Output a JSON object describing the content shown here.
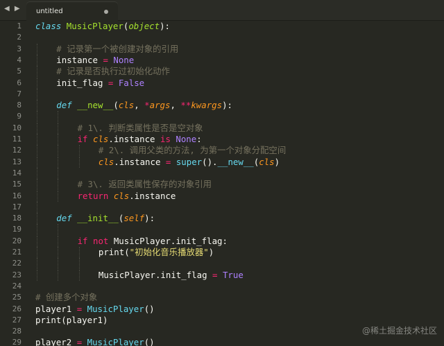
{
  "tabbar": {
    "back_icon": "◀",
    "forward_icon": "▶",
    "tab_title": "untitled",
    "dirty_indicator": "unsaved-dot"
  },
  "editor": {
    "colors": {
      "background": "#272822",
      "keyword": "#66d9ef",
      "class_name": "#a6e22e",
      "comment": "#75715e",
      "operator": "#f92672",
      "constant": "#ae81ff",
      "string": "#e6db74",
      "parameter": "#fd971f",
      "text": "#f8f8f2"
    },
    "lines": [
      {
        "n": "1",
        "indent": 0,
        "tokens": [
          [
            "kw",
            "class"
          ],
          [
            "plain",
            " "
          ],
          [
            "cls",
            "MusicPlayer"
          ],
          [
            "plain",
            "("
          ],
          [
            "base",
            "object"
          ],
          [
            "plain",
            "):"
          ]
        ]
      },
      {
        "n": "2",
        "indent": 0,
        "tokens": []
      },
      {
        "n": "3",
        "indent": 1,
        "tokens": [
          [
            "cm",
            "# 记录第一个被创建对象的引用"
          ]
        ]
      },
      {
        "n": "4",
        "indent": 1,
        "tokens": [
          [
            "plain",
            "instance "
          ],
          [
            "op",
            "="
          ],
          [
            "plain",
            " "
          ],
          [
            "const",
            "None"
          ]
        ]
      },
      {
        "n": "5",
        "indent": 1,
        "tokens": [
          [
            "cm",
            "# 记录是否执行过初始化动作"
          ]
        ]
      },
      {
        "n": "6",
        "indent": 1,
        "tokens": [
          [
            "plain",
            "init_flag "
          ],
          [
            "op",
            "="
          ],
          [
            "plain",
            " "
          ],
          [
            "const",
            "False"
          ]
        ]
      },
      {
        "n": "7",
        "indent": 1,
        "tokens": []
      },
      {
        "n": "8",
        "indent": 1,
        "tokens": [
          [
            "kw",
            "def"
          ],
          [
            "plain",
            " "
          ],
          [
            "fn",
            "__new__"
          ],
          [
            "plain",
            "("
          ],
          [
            "param",
            "cls"
          ],
          [
            "plain",
            ", "
          ],
          [
            "op",
            "*"
          ],
          [
            "param",
            "args"
          ],
          [
            "plain",
            ", "
          ],
          [
            "op",
            "**"
          ],
          [
            "param",
            "kwargs"
          ],
          [
            "plain",
            "):"
          ]
        ]
      },
      {
        "n": "9",
        "indent": 2,
        "tokens": []
      },
      {
        "n": "10",
        "indent": 2,
        "tokens": [
          [
            "cm",
            "# 1\\. 判断类属性是否是空对象"
          ]
        ]
      },
      {
        "n": "11",
        "indent": 2,
        "tokens": [
          [
            "ctrl",
            "if"
          ],
          [
            "plain",
            " "
          ],
          [
            "param",
            "cls"
          ],
          [
            "plain",
            ".instance "
          ],
          [
            "ctrl",
            "is"
          ],
          [
            "plain",
            " "
          ],
          [
            "const",
            "None"
          ],
          [
            "plain",
            ":"
          ]
        ]
      },
      {
        "n": "12",
        "indent": 3,
        "tokens": [
          [
            "cm",
            "# 2\\. 调用父类的方法, 为第一个对象分配空间"
          ]
        ]
      },
      {
        "n": "13",
        "indent": 3,
        "tokens": [
          [
            "param",
            "cls"
          ],
          [
            "plain",
            ".instance "
          ],
          [
            "op",
            "="
          ],
          [
            "plain",
            " "
          ],
          [
            "bi",
            "super"
          ],
          [
            "plain",
            "()."
          ],
          [
            "bi",
            "__new__"
          ],
          [
            "plain",
            "("
          ],
          [
            "param",
            "cls"
          ],
          [
            "plain",
            ")"
          ]
        ]
      },
      {
        "n": "14",
        "indent": 2,
        "tokens": []
      },
      {
        "n": "15",
        "indent": 2,
        "tokens": [
          [
            "cm",
            "# 3\\. 返回类属性保存的对象引用"
          ]
        ]
      },
      {
        "n": "16",
        "indent": 2,
        "tokens": [
          [
            "ctrl",
            "return"
          ],
          [
            "plain",
            " "
          ],
          [
            "param",
            "cls"
          ],
          [
            "plain",
            ".instance"
          ]
        ]
      },
      {
        "n": "17",
        "indent": 1,
        "tokens": []
      },
      {
        "n": "18",
        "indent": 1,
        "tokens": [
          [
            "kw",
            "def"
          ],
          [
            "plain",
            " "
          ],
          [
            "fn",
            "__init__"
          ],
          [
            "plain",
            "("
          ],
          [
            "param",
            "self"
          ],
          [
            "plain",
            "):"
          ]
        ]
      },
      {
        "n": "19",
        "indent": 2,
        "tokens": []
      },
      {
        "n": "20",
        "indent": 2,
        "tokens": [
          [
            "ctrl",
            "if"
          ],
          [
            "plain",
            " "
          ],
          [
            "ctrl",
            "not"
          ],
          [
            "plain",
            " MusicPlayer.init_flag:"
          ]
        ]
      },
      {
        "n": "21",
        "indent": 3,
        "tokens": [
          [
            "plain",
            "print("
          ],
          [
            "str",
            "\"初始化音乐播放器\""
          ],
          [
            "plain",
            ")"
          ]
        ]
      },
      {
        "n": "22",
        "indent": 3,
        "tokens": []
      },
      {
        "n": "23",
        "indent": 3,
        "tokens": [
          [
            "plain",
            "MusicPlayer.init_flag "
          ],
          [
            "op",
            "="
          ],
          [
            "plain",
            " "
          ],
          [
            "const",
            "True"
          ]
        ]
      },
      {
        "n": "24",
        "indent": 0,
        "tokens": []
      },
      {
        "n": "25",
        "indent": 0,
        "tokens": [
          [
            "cm",
            "# 创建多个对象"
          ]
        ]
      },
      {
        "n": "26",
        "indent": 0,
        "tokens": [
          [
            "plain",
            "player1 "
          ],
          [
            "op",
            "="
          ],
          [
            "plain",
            " "
          ],
          [
            "bi",
            "MusicPlayer"
          ],
          [
            "plain",
            "()"
          ]
        ]
      },
      {
        "n": "27",
        "indent": 0,
        "tokens": [
          [
            "plain",
            "print(player1)"
          ]
        ]
      },
      {
        "n": "28",
        "indent": 0,
        "tokens": []
      },
      {
        "n": "29",
        "indent": 0,
        "tokens": [
          [
            "plain",
            "player2 "
          ],
          [
            "op",
            "="
          ],
          [
            "plain",
            " "
          ],
          [
            "bi",
            "MusicPlayer"
          ],
          [
            "plain",
            "()"
          ]
        ]
      }
    ]
  },
  "watermark": "@稀土掘金技术社区"
}
